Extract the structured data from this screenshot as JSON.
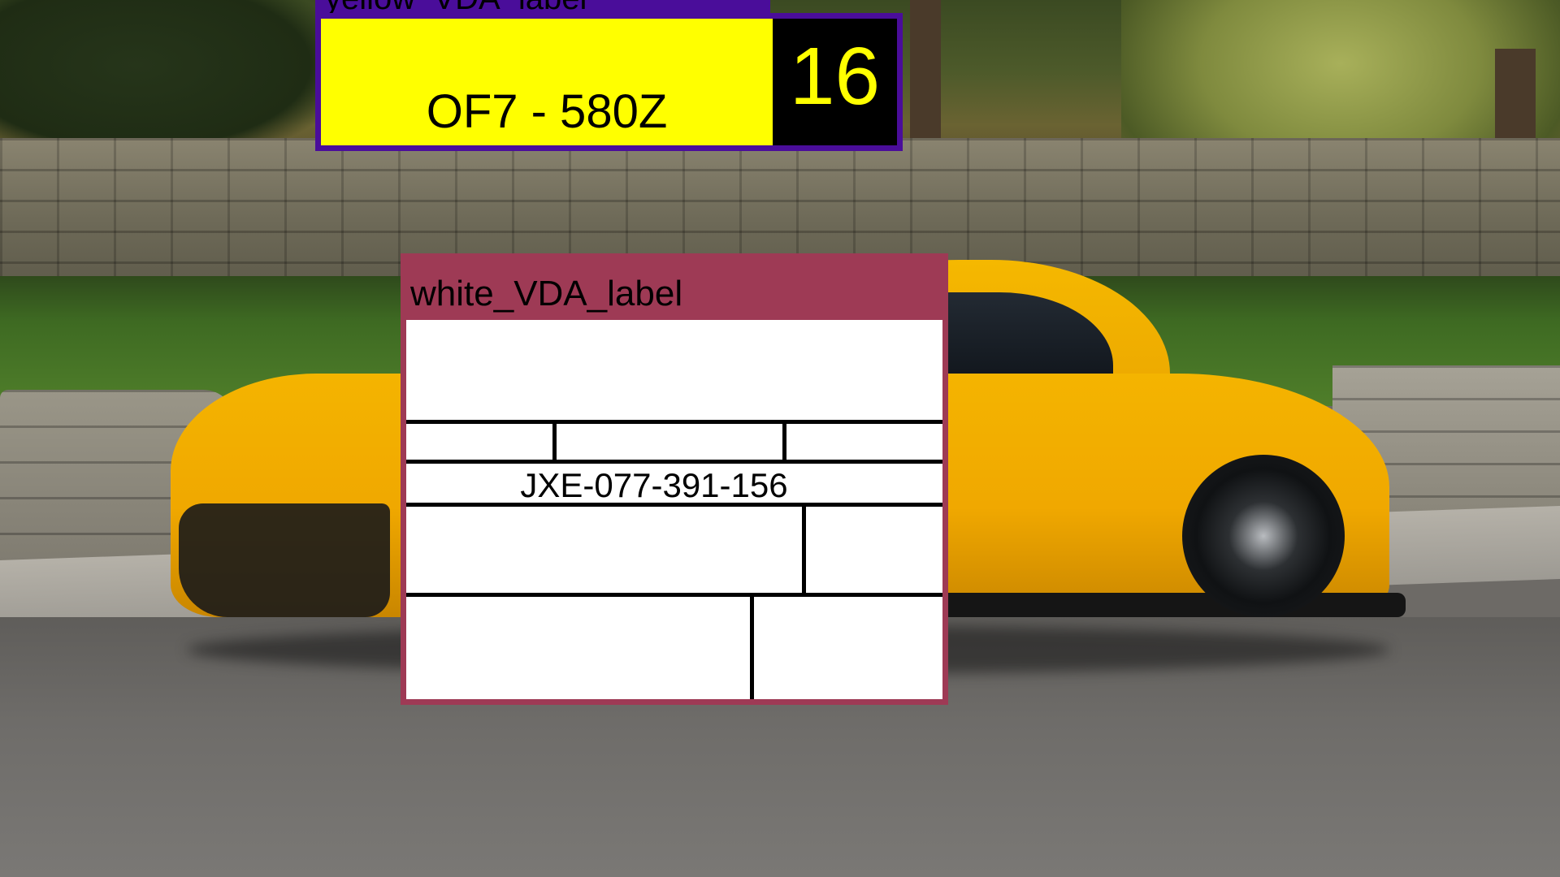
{
  "labels": {
    "yellow": {
      "title": "yellow_VDA_label",
      "plate": "OF7 - 580Z",
      "number": "16",
      "frame_color": "#4a0d9a",
      "fill_color": "#ffff00"
    },
    "white": {
      "title": "white_VDA_label",
      "code": "JXE-077-391-156",
      "frame_color": "#9e3a55",
      "fill_color": "#ffffff"
    }
  },
  "scene": {
    "subject": "yellow sports car",
    "car_color": "#f4b400"
  }
}
